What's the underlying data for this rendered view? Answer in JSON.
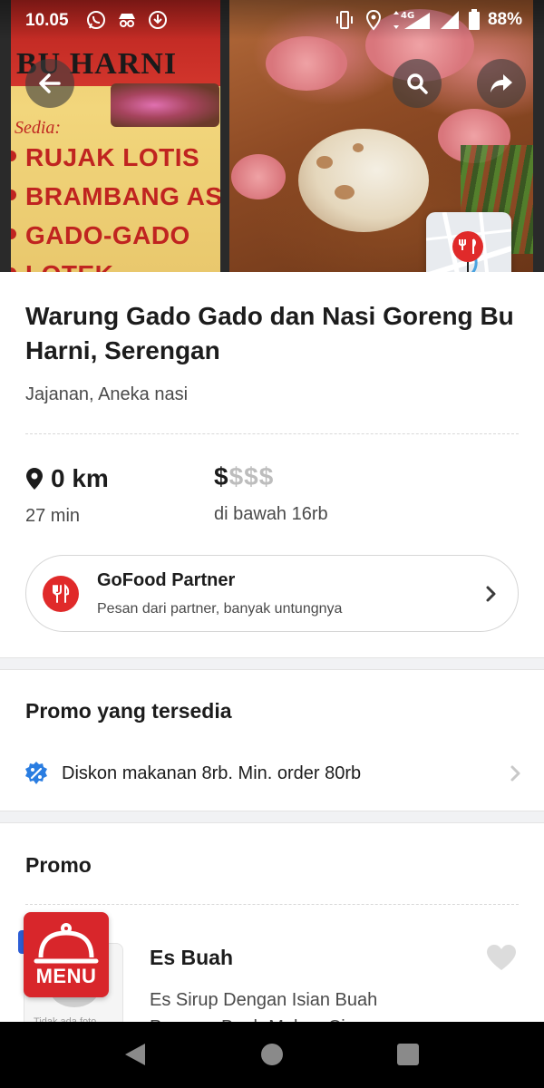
{
  "status_bar": {
    "time": "10.05",
    "network": "4G",
    "battery": "88%"
  },
  "hero": {
    "sign_title": "BU HARNI",
    "sign_subtitle": "Sedia:",
    "sign_items": [
      "RUJAK LOTIS",
      "BRAMBANG ASEM",
      "GADO-GADO",
      "LOTEK"
    ]
  },
  "restaurant": {
    "name": "Warung Gado Gado dan Nasi Goreng Bu Harni, Serengan",
    "cuisine": "Jajanan, Aneka nasi",
    "distance": "0 km",
    "time": "27 min",
    "price_active": "$",
    "price_inactive": "$$$",
    "price_note": "di bawah 16rb"
  },
  "partner": {
    "title": "GoFood Partner",
    "subtitle": "Pesan dari partner, banyak untungnya"
  },
  "promo_available": {
    "heading": "Promo yang tersedia",
    "items": [
      "Diskon makanan 8rb. Min. order 80rb"
    ]
  },
  "promo_section": {
    "heading": "Promo",
    "items": [
      {
        "name": "Es Buah",
        "description": "Es Sirup Dengan Isian Buah Pepaya, Buah Melon, Cincau",
        "image_caption": "Tidak ada foto"
      }
    ]
  },
  "menu_button": {
    "label": "MENU"
  },
  "colors": {
    "brand_red": "#e02a2a",
    "promo_blue": "#2a7de1"
  }
}
